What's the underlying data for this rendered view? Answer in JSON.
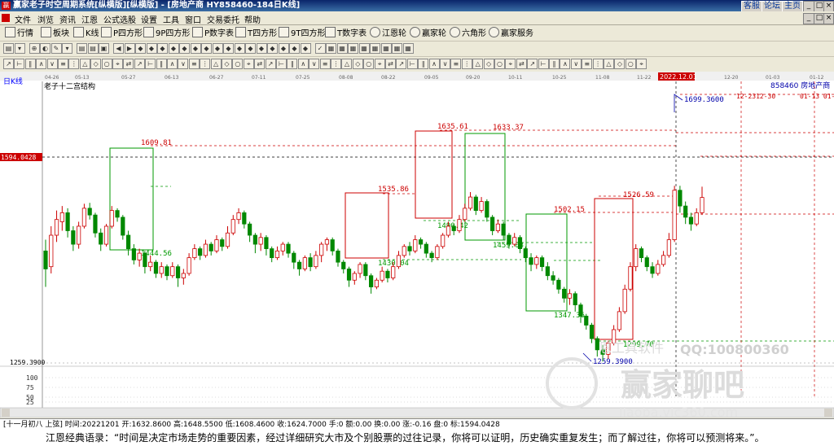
{
  "window": {
    "title": "赢家老子时空周期系统[纵横版][纵横版] - [房地产商  HY858460-184日K线]",
    "links": [
      "客服",
      "论坛",
      "主页"
    ]
  },
  "menu": [
    "文件",
    "浏览",
    "资讯",
    "江恩",
    "公式选股",
    "设置",
    "工具",
    "窗口",
    "交易委托",
    "帮助"
  ],
  "toolbar1": [
    "行情",
    "板块",
    "K线",
    "P四方形",
    "9P四方形",
    "P数字表",
    "T四方形",
    "9T四方形",
    "T数字表",
    "江恩轮",
    "赢家轮",
    "六角形",
    "赢家服务"
  ],
  "chart": {
    "period_label": "日K线",
    "structure_label": "老子十二宫结构",
    "dates": [
      "04-26",
      "05-13",
      "05-27",
      "06-13",
      "06-27",
      "07-11",
      "07-25",
      "08-08",
      "08-22",
      "09-05",
      "09-20",
      "10-11",
      "10-25",
      "11-08",
      "11-22",
      "2022.12.01",
      "12-20",
      "01-03",
      "01-12"
    ],
    "code_name": "858460 房地产商",
    "future_dates": "12-2312-30",
    "future_dates2": "01-13 01-",
    "price_tag": "1594.0428",
    "low_tag": "1259.3900",
    "levels": [
      "1609.81",
      "1444.56",
      "1635.61",
      "1633.37",
      "1535.86",
      "1430.04",
      "1490.42",
      "1459.08",
      "1502.15",
      "1347.36",
      "1526.59",
      "1299.70",
      "1699.3600",
      "1259.3900"
    ],
    "sub_axis": [
      "100",
      "75",
      "50",
      "25"
    ],
    "candles": [
      {
        "o": 1505,
        "c": 1465,
        "h": 1530,
        "l": 1425
      },
      {
        "o": 1470,
        "c": 1540,
        "h": 1560,
        "l": 1455
      },
      {
        "o": 1540,
        "c": 1575,
        "h": 1595,
        "l": 1525
      },
      {
        "o": 1570,
        "c": 1590,
        "h": 1605,
        "l": 1550
      },
      {
        "o": 1590,
        "c": 1550,
        "h": 1600,
        "l": 1535
      },
      {
        "o": 1550,
        "c": 1520,
        "h": 1560,
        "l": 1505
      },
      {
        "o": 1520,
        "c": 1560,
        "h": 1570,
        "l": 1510
      },
      {
        "o": 1560,
        "c": 1600,
        "h": 1610,
        "l": 1555
      },
      {
        "o": 1600,
        "c": 1585,
        "h": 1612,
        "l": 1575
      },
      {
        "o": 1585,
        "c": 1545,
        "h": 1590,
        "l": 1535
      },
      {
        "o": 1545,
        "c": 1520,
        "h": 1555,
        "l": 1505
      },
      {
        "o": 1520,
        "c": 1560,
        "h": 1565,
        "l": 1515
      },
      {
        "o": 1560,
        "c": 1595,
        "h": 1605,
        "l": 1555
      },
      {
        "o": 1595,
        "c": 1580,
        "h": 1600,
        "l": 1570
      },
      {
        "o": 1580,
        "c": 1540,
        "h": 1585,
        "l": 1530
      },
      {
        "o": 1540,
        "c": 1510,
        "h": 1550,
        "l": 1495
      },
      {
        "o": 1510,
        "c": 1485,
        "h": 1520,
        "l": 1475
      },
      {
        "o": 1485,
        "c": 1500,
        "h": 1510,
        "l": 1470
      },
      {
        "o": 1500,
        "c": 1470,
        "h": 1505,
        "l": 1455
      },
      {
        "o": 1470,
        "c": 1480,
        "h": 1495,
        "l": 1460
      },
      {
        "o": 1480,
        "c": 1455,
        "h": 1485,
        "l": 1445
      },
      {
        "o": 1455,
        "c": 1470,
        "h": 1480,
        "l": 1445
      },
      {
        "o": 1470,
        "c": 1450,
        "h": 1475,
        "l": 1440
      },
      {
        "o": 1450,
        "c": 1470,
        "h": 1480,
        "l": 1445
      },
      {
        "o": 1470,
        "c": 1445,
        "h": 1475,
        "l": 1425
      },
      {
        "o": 1445,
        "c": 1455,
        "h": 1465,
        "l": 1430
      },
      {
        "o": 1455,
        "c": 1490,
        "h": 1500,
        "l": 1450
      },
      {
        "o": 1490,
        "c": 1510,
        "h": 1520,
        "l": 1485
      },
      {
        "o": 1510,
        "c": 1495,
        "h": 1515,
        "l": 1485
      },
      {
        "o": 1495,
        "c": 1520,
        "h": 1530,
        "l": 1490
      },
      {
        "o": 1520,
        "c": 1505,
        "h": 1525,
        "l": 1495
      },
      {
        "o": 1505,
        "c": 1530,
        "h": 1540,
        "l": 1500
      },
      {
        "o": 1530,
        "c": 1515,
        "h": 1535,
        "l": 1505
      },
      {
        "o": 1515,
        "c": 1545,
        "h": 1560,
        "l": 1510
      },
      {
        "o": 1545,
        "c": 1575,
        "h": 1585,
        "l": 1540
      },
      {
        "o": 1575,
        "c": 1590,
        "h": 1600,
        "l": 1565
      },
      {
        "o": 1590,
        "c": 1565,
        "h": 1595,
        "l": 1555
      },
      {
        "o": 1565,
        "c": 1540,
        "h": 1570,
        "l": 1525
      },
      {
        "o": 1540,
        "c": 1520,
        "h": 1545,
        "l": 1500
      },
      {
        "o": 1520,
        "c": 1535,
        "h": 1545,
        "l": 1505
      },
      {
        "o": 1535,
        "c": 1510,
        "h": 1540,
        "l": 1495
      },
      {
        "o": 1510,
        "c": 1490,
        "h": 1515,
        "l": 1480
      },
      {
        "o": 1490,
        "c": 1505,
        "h": 1515,
        "l": 1485
      },
      {
        "o": 1505,
        "c": 1520,
        "h": 1525,
        "l": 1495
      },
      {
        "o": 1520,
        "c": 1500,
        "h": 1525,
        "l": 1490
      },
      {
        "o": 1500,
        "c": 1480,
        "h": 1505,
        "l": 1465
      },
      {
        "o": 1480,
        "c": 1465,
        "h": 1485,
        "l": 1450
      },
      {
        "o": 1465,
        "c": 1490,
        "h": 1495,
        "l": 1460
      },
      {
        "o": 1490,
        "c": 1470,
        "h": 1500,
        "l": 1460
      },
      {
        "o": 1470,
        "c": 1495,
        "h": 1505,
        "l": 1465
      },
      {
        "o": 1495,
        "c": 1520,
        "h": 1525,
        "l": 1480
      },
      {
        "o": 1520,
        "c": 1530,
        "h": 1535,
        "l": 1505
      },
      {
        "o": 1530,
        "c": 1505,
        "h": 1535,
        "l": 1495
      },
      {
        "o": 1505,
        "c": 1480,
        "h": 1510,
        "l": 1470
      },
      {
        "o": 1480,
        "c": 1465,
        "h": 1485,
        "l": 1455
      },
      {
        "o": 1465,
        "c": 1440,
        "h": 1470,
        "l": 1425
      },
      {
        "o": 1440,
        "c": 1455,
        "h": 1460,
        "l": 1430
      },
      {
        "o": 1455,
        "c": 1475,
        "h": 1480,
        "l": 1445
      },
      {
        "o": 1475,
        "c": 1450,
        "h": 1480,
        "l": 1440
      },
      {
        "o": 1450,
        "c": 1425,
        "h": 1455,
        "l": 1410
      },
      {
        "o": 1425,
        "c": 1440,
        "h": 1445,
        "l": 1420
      },
      {
        "o": 1440,
        "c": 1460,
        "h": 1470,
        "l": 1435
      },
      {
        "o": 1460,
        "c": 1445,
        "h": 1465,
        "l": 1435
      },
      {
        "o": 1445,
        "c": 1470,
        "h": 1480,
        "l": 1440
      },
      {
        "o": 1470,
        "c": 1495,
        "h": 1505,
        "l": 1465
      },
      {
        "o": 1495,
        "c": 1515,
        "h": 1520,
        "l": 1490
      },
      {
        "o": 1515,
        "c": 1505,
        "h": 1525,
        "l": 1495
      },
      {
        "o": 1505,
        "c": 1530,
        "h": 1540,
        "l": 1500
      },
      {
        "o": 1530,
        "c": 1520,
        "h": 1535,
        "l": 1510
      },
      {
        "o": 1520,
        "c": 1500,
        "h": 1525,
        "l": 1490
      },
      {
        "o": 1500,
        "c": 1490,
        "h": 1505,
        "l": 1480
      },
      {
        "o": 1490,
        "c": 1515,
        "h": 1520,
        "l": 1485
      },
      {
        "o": 1515,
        "c": 1540,
        "h": 1545,
        "l": 1510
      },
      {
        "o": 1540,
        "c": 1560,
        "h": 1570,
        "l": 1535
      },
      {
        "o": 1560,
        "c": 1550,
        "h": 1565,
        "l": 1540
      },
      {
        "o": 1550,
        "c": 1575,
        "h": 1585,
        "l": 1545
      },
      {
        "o": 1575,
        "c": 1600,
        "h": 1610,
        "l": 1570
      },
      {
        "o": 1600,
        "c": 1625,
        "h": 1636,
        "l": 1595
      },
      {
        "o": 1625,
        "c": 1595,
        "h": 1630,
        "l": 1585
      },
      {
        "o": 1595,
        "c": 1615,
        "h": 1625,
        "l": 1590
      },
      {
        "o": 1615,
        "c": 1580,
        "h": 1620,
        "l": 1570
      },
      {
        "o": 1580,
        "c": 1550,
        "h": 1585,
        "l": 1540
      },
      {
        "o": 1550,
        "c": 1565,
        "h": 1575,
        "l": 1545
      },
      {
        "o": 1565,
        "c": 1540,
        "h": 1570,
        "l": 1530
      },
      {
        "o": 1540,
        "c": 1520,
        "h": 1545,
        "l": 1510
      },
      {
        "o": 1520,
        "c": 1535,
        "h": 1545,
        "l": 1515
      },
      {
        "o": 1535,
        "c": 1510,
        "h": 1540,
        "l": 1500
      },
      {
        "o": 1510,
        "c": 1490,
        "h": 1515,
        "l": 1480
      },
      {
        "o": 1490,
        "c": 1475,
        "h": 1500,
        "l": 1460
      },
      {
        "o": 1475,
        "c": 1490,
        "h": 1495,
        "l": 1465
      },
      {
        "o": 1490,
        "c": 1470,
        "h": 1495,
        "l": 1460
      },
      {
        "o": 1470,
        "c": 1450,
        "h": 1480,
        "l": 1440
      },
      {
        "o": 1450,
        "c": 1440,
        "h": 1460,
        "l": 1430
      },
      {
        "o": 1440,
        "c": 1420,
        "h": 1445,
        "l": 1410
      },
      {
        "o": 1420,
        "c": 1400,
        "h": 1425,
        "l": 1390
      },
      {
        "o": 1400,
        "c": 1410,
        "h": 1420,
        "l": 1385
      },
      {
        "o": 1410,
        "c": 1385,
        "h": 1415,
        "l": 1370
      },
      {
        "o": 1385,
        "c": 1360,
        "h": 1390,
        "l": 1345
      },
      {
        "o": 1360,
        "c": 1340,
        "h": 1365,
        "l": 1330
      },
      {
        "o": 1340,
        "c": 1310,
        "h": 1345,
        "l": 1300
      },
      {
        "o": 1310,
        "c": 1285,
        "h": 1315,
        "l": 1270
      },
      {
        "o": 1285,
        "c": 1275,
        "h": 1295,
        "l": 1259
      },
      {
        "o": 1275,
        "c": 1300,
        "h": 1305,
        "l": 1265
      },
      {
        "o": 1300,
        "c": 1330,
        "h": 1340,
        "l": 1295
      },
      {
        "o": 1330,
        "c": 1370,
        "h": 1380,
        "l": 1325
      },
      {
        "o": 1370,
        "c": 1420,
        "h": 1430,
        "l": 1365
      },
      {
        "o": 1420,
        "c": 1470,
        "h": 1480,
        "l": 1415
      },
      {
        "o": 1470,
        "c": 1510,
        "h": 1520,
        "l": 1460
      },
      {
        "o": 1510,
        "c": 1490,
        "h": 1515,
        "l": 1480
      },
      {
        "o": 1490,
        "c": 1470,
        "h": 1495,
        "l": 1460
      },
      {
        "o": 1470,
        "c": 1455,
        "h": 1480,
        "l": 1445
      },
      {
        "o": 1455,
        "c": 1475,
        "h": 1485,
        "l": 1450
      },
      {
        "o": 1475,
        "c": 1495,
        "h": 1505,
        "l": 1470
      },
      {
        "o": 1495,
        "c": 1530,
        "h": 1545,
        "l": 1490
      },
      {
        "o": 1530,
        "c": 1640,
        "h": 1650,
        "l": 1525
      },
      {
        "o": 1640,
        "c": 1605,
        "h": 1650,
        "l": 1590
      },
      {
        "o": 1605,
        "c": 1580,
        "h": 1615,
        "l": 1565
      },
      {
        "o": 1580,
        "c": 1565,
        "h": 1590,
        "l": 1550
      },
      {
        "o": 1565,
        "c": 1590,
        "h": 1600,
        "l": 1560
      },
      {
        "o": 1590,
        "c": 1624,
        "h": 1648,
        "l": 1585
      }
    ]
  },
  "status": "[十一月初八  上弦] 时间:20221201 开:1632.8600 高:1648.5500 低:1608.4600 收:1624.7000 手:0 额:0.00 换:0.00 涨:-0.16 盘:0 标:1594.0428",
  "quote": "江恩经典语录：“时间是决定市场走势的重要因素，经过详细研究大市及个别股票的过往记录，你将可以证明，历史确实重复发生；而了解过往，你将可以预测将来。”。",
  "watermark": {
    "qq": "QQ:100800360",
    "brand": "赢家聊吧",
    "url": "liaoba.vic360.com",
    "soft": "恩工具软件"
  }
}
